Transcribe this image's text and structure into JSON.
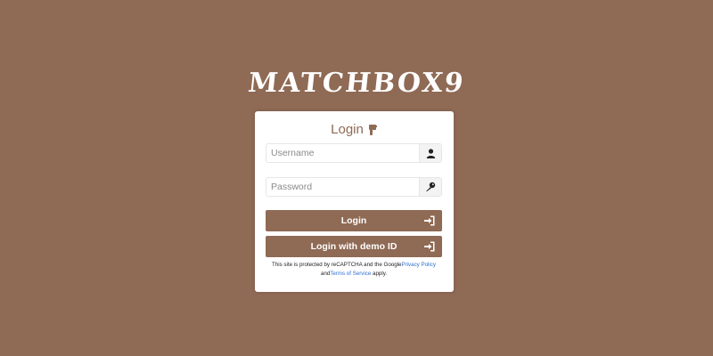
{
  "brand": {
    "logo_text": "MATCHBOX9"
  },
  "login": {
    "title": "Login",
    "title_icon": "hand-pointing-icon",
    "username": {
      "placeholder": "Username",
      "value": "",
      "icon": "user-icon"
    },
    "password": {
      "placeholder": "Password",
      "value": "",
      "icon": "key-icon"
    },
    "login_button": {
      "label": "Login",
      "icon": "sign-in-icon"
    },
    "demo_button": {
      "label": "Login with demo ID",
      "icon": "sign-in-icon"
    },
    "recaptcha": {
      "prefix": "This site is protected by reCAPTCHA and the Google",
      "privacy_link": "Privacy Policy",
      "middle": " and",
      "terms_link": "Terms of Service",
      "suffix": " apply."
    }
  },
  "colors": {
    "background": "#8f6a55",
    "accent": "#8f6a55",
    "card": "#ffffff",
    "link": "#2f6fd0"
  }
}
